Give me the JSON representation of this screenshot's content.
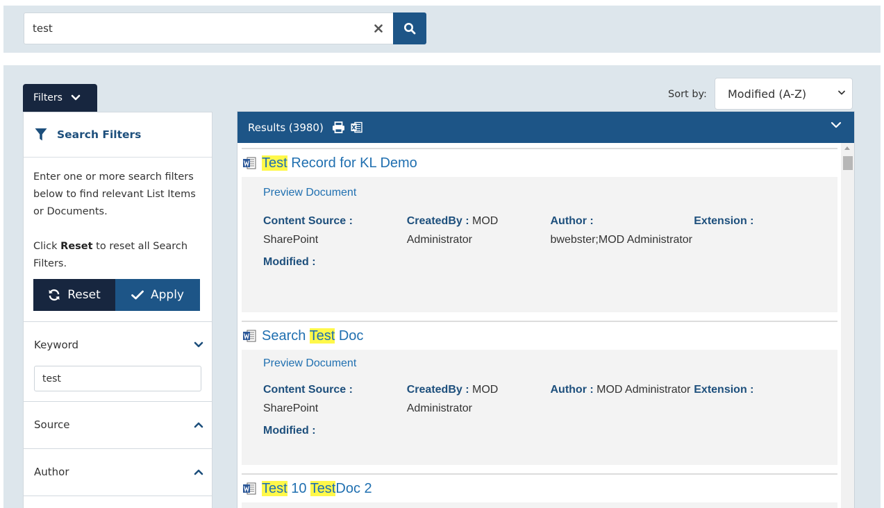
{
  "search": {
    "value": "test",
    "clear_icon": "close-icon",
    "search_icon": "search-icon"
  },
  "filters_tab": {
    "label": "Filters"
  },
  "filters_panel": {
    "title": "Search Filters",
    "desc_1": "Enter one or more search filters below to find relevant List Items or Documents.",
    "desc_2_pre": "Click ",
    "desc_2_bold": "Reset",
    "desc_2_post": " to reset all Search Filters.",
    "reset_label": "Reset",
    "apply_label": "Apply",
    "sections": [
      {
        "label": "Keyword",
        "expanded": true,
        "value": "test"
      },
      {
        "label": "Source",
        "expanded": false
      },
      {
        "label": "Author",
        "expanded": false
      }
    ]
  },
  "sort": {
    "label": "Sort by:",
    "selected": "Modified (A-Z)"
  },
  "results": {
    "header": "Results (3980)",
    "items": [
      {
        "title_parts": [
          {
            "text": "Test",
            "hl": true
          },
          {
            "text": " Record for KL Demo",
            "hl": false
          }
        ],
        "preview": "Preview Document",
        "content_source_label": "Content Source :",
        "content_source": "SharePoint",
        "created_by_label": "CreatedBy :",
        "created_by": "MOD Administrator",
        "author_label": "Author :",
        "author": "bwebster;MOD Administrator",
        "extension_label": "Extension :",
        "modified_label": "Modified :"
      },
      {
        "title_parts": [
          {
            "text": "Search ",
            "hl": false
          },
          {
            "text": "Test",
            "hl": true
          },
          {
            "text": " Doc",
            "hl": false
          }
        ],
        "preview": "Preview Document",
        "content_source_label": "Content Source :",
        "content_source": "SharePoint",
        "created_by_label": "CreatedBy :",
        "created_by": "MOD Administrator",
        "author_label": "Author :",
        "author": "MOD Administrator",
        "extension_label": "Extension :",
        "modified_label": "Modified :"
      },
      {
        "title_parts": [
          {
            "text": "Test",
            "hl": true
          },
          {
            "text": " 10 ",
            "hl": false
          },
          {
            "text": "Test",
            "hl": true
          },
          {
            "text": "Doc 2",
            "hl": false
          }
        ]
      }
    ]
  }
}
